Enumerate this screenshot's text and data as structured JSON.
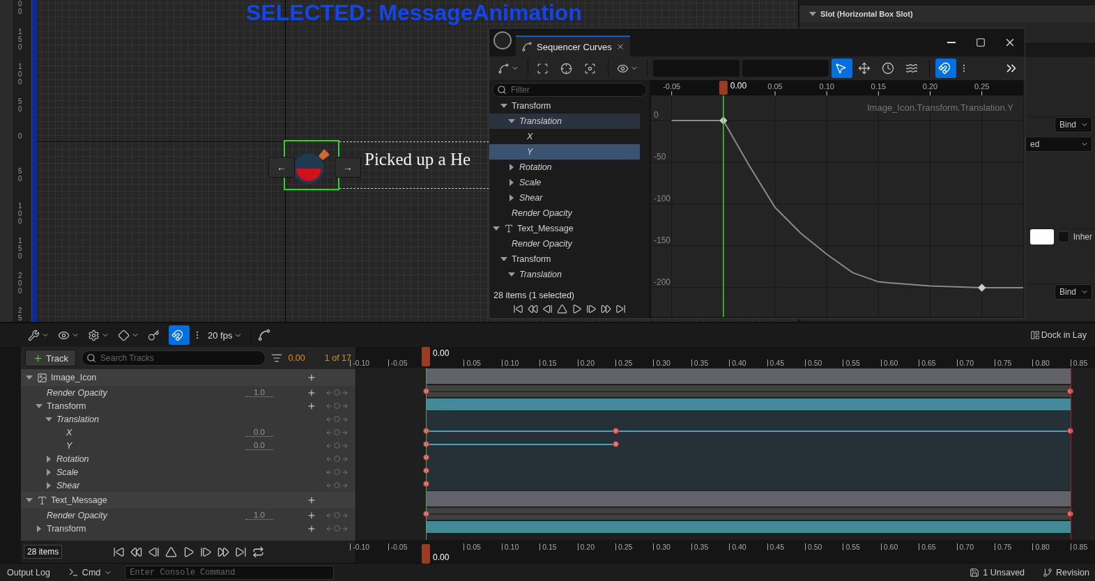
{
  "viewport": {
    "banner": "SELECTED: MessageAnimation",
    "ruler_labels": [
      "00",
      "150",
      "100",
      "50",
      "0",
      "50",
      "100",
      "150",
      "200",
      "25"
    ],
    "widget": {
      "message": "Picked up a He",
      "arrows": [
        "←",
        "→"
      ]
    }
  },
  "details": {
    "section_title": "Slot (Horizontal Box Slot)",
    "rows": [
      {
        "kind": "dropdown",
        "value": "Bind"
      },
      {
        "kind": "combo",
        "value": "ed"
      },
      {
        "kind": "color",
        "label": "Inher",
        "checked": false
      },
      {
        "kind": "dropdown",
        "value": "Bind"
      }
    ]
  },
  "curves_window": {
    "tab": "Sequencer Curves",
    "tools": [
      {
        "selected": false
      },
      {
        "selected": false
      },
      {
        "selected": false
      },
      {
        "selected": false
      },
      {
        "selected": false
      },
      {
        "selected": true
      },
      {
        "selected": false
      },
      {
        "selected": false
      },
      {
        "selected": false
      },
      {
        "selected": true
      }
    ],
    "filter": {
      "placeholder": "Filter"
    },
    "tree": [
      {
        "label": "Transform",
        "kind": "group",
        "expanded": true,
        "selected": false,
        "highlighted": false,
        "children": [
          {
            "label": "Translation",
            "kind": "property",
            "expanded": true,
            "selected": false,
            "highlighted": true,
            "children": [
              {
                "label": "X",
                "kind": "property",
                "selected": false,
                "highlighted": false
              },
              {
                "label": "Y",
                "kind": "property",
                "selected": true,
                "highlighted": false
              }
            ]
          },
          {
            "label": "Rotation",
            "kind": "property",
            "expanded": false,
            "selected": false,
            "highlighted": false
          },
          {
            "label": "Scale",
            "kind": "property",
            "expanded": false,
            "selected": false,
            "highlighted": false
          },
          {
            "label": "Shear",
            "kind": "property",
            "expanded": false,
            "selected": false,
            "highlighted": false
          }
        ]
      },
      {
        "label": "Render Opacity",
        "kind": "property",
        "selected": false,
        "highlighted": false
      },
      {
        "label": "Text_Message",
        "kind": "text",
        "expanded": true,
        "selected": false,
        "highlighted": false,
        "children": [
          {
            "label": "Render Opacity",
            "kind": "property",
            "selected": false,
            "highlighted": false
          },
          {
            "label": "Transform",
            "kind": "group",
            "expanded": true,
            "selected": false,
            "highlighted": false,
            "children": [
              {
                "label": "Translation",
                "kind": "property",
                "expanded": true,
                "selected": false,
                "highlighted": false
              }
            ]
          }
        ]
      }
    ],
    "footer": "28 items (1 selected)",
    "chart_data": {
      "type": "line",
      "x": [
        -0.05,
        0,
        0.025,
        0.05,
        0.075,
        0.1,
        0.125,
        0.15,
        0.2,
        0.25,
        0.29
      ],
      "series": [
        {
          "name": "Image_Icon.Transform.Translation.Y",
          "color": "#8a8a8a",
          "values": [
            0,
            0,
            -54,
            -104,
            -135,
            -160,
            -182,
            -193,
            -198,
            -200,
            -200
          ]
        }
      ],
      "xlim": [
        -0.07,
        0.29
      ],
      "ylim": [
        -235,
        30
      ],
      "xticks": [
        {
          "value": -0.05,
          "label": "-0.05"
        },
        {
          "value": 0.05,
          "label": "0.05"
        },
        {
          "value": 0.1,
          "label": "0.10"
        },
        {
          "value": 0.15,
          "label": "0.15"
        },
        {
          "value": 0.2,
          "label": "0.20"
        },
        {
          "value": 0.25,
          "label": "0.25"
        }
      ],
      "yticks": [
        0,
        -50,
        -100,
        -150,
        -200
      ],
      "grid": true,
      "ref_lines": [
        {
          "axis": "x",
          "value": 0,
          "label": "0.00"
        }
      ]
    }
  },
  "sequencer": {
    "tools": [
      {
        "selected": false
      },
      {
        "selected": false
      },
      {
        "selected": false
      },
      {
        "selected": false
      },
      {
        "selected": false
      },
      {
        "selected": true
      }
    ],
    "fps": "20 fps",
    "dock": "Dock in Lay",
    "add_track": "Track",
    "search": {
      "placeholder": "Search Tracks"
    },
    "time": "0.00",
    "counter": "1 of 17",
    "tracks": [
      {
        "label": "Image_Icon",
        "kind": "image",
        "expanded": true,
        "addable": true,
        "children": [
          {
            "label": "Render Opacity",
            "kind": "property",
            "value": "1.0",
            "addable": true
          },
          {
            "label": "Transform",
            "kind": "group",
            "expanded": true,
            "addable": true,
            "children": [
              {
                "label": "Translation",
                "kind": "property",
                "expanded": true,
                "addable": false,
                "children": [
                  {
                    "label": "X",
                    "kind": "property",
                    "value": "0.0",
                    "addable": false
                  },
                  {
                    "label": "Y",
                    "kind": "property",
                    "value": "0.0",
                    "addable": false
                  }
                ]
              },
              {
                "label": "Rotation",
                "kind": "property",
                "expanded": false,
                "addable": false
              },
              {
                "label": "Scale",
                "kind": "property",
                "expanded": false,
                "addable": false
              },
              {
                "label": "Shear",
                "kind": "property",
                "expanded": false,
                "addable": false
              }
            ]
          }
        ]
      },
      {
        "label": "Text_Message",
        "kind": "text",
        "expanded": true,
        "addable": true,
        "children": [
          {
            "label": "Render Opacity",
            "kind": "property",
            "value": "1.0",
            "addable": true
          },
          {
            "label": "Transform",
            "kind": "group",
            "expanded": false,
            "addable": true
          }
        ]
      }
    ],
    "tooltip": "28 items",
    "ruler_top": {
      "playhead": "0.00",
      "labels": [
        "-0.10",
        "-0.05",
        "0.05",
        "0.10",
        "0.15",
        "0.20",
        "0.25",
        "0.30",
        "0.35",
        "0.40",
        "0.45",
        "0.50",
        "0.55",
        "0.60",
        "0.65",
        "0.70",
        "0.75",
        "0.80",
        "0.85"
      ]
    },
    "ruler_bottom": {
      "playhead": "0.00",
      "labels": [
        "-0.10",
        "-0.05",
        "0.05",
        "0.10",
        "0.15",
        "0.20",
        "0.25",
        "0.30",
        "0.35",
        "0.40",
        "0.45",
        "0.50",
        "0.55",
        "0.60",
        "0.65",
        "0.70",
        "0.75",
        "0.80",
        "0.85"
      ]
    }
  },
  "status_bar": {
    "output_log": "Output Log",
    "cmd": "Cmd",
    "console": {
      "placeholder": "Enter Console Command"
    },
    "unsaved": "1 Unsaved",
    "revision": "Revision"
  }
}
